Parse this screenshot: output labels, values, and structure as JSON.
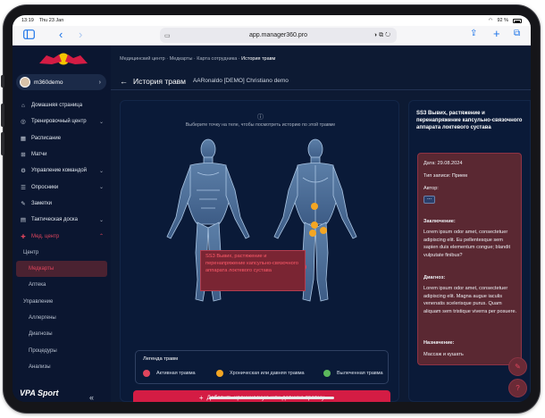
{
  "status_bar": {
    "time": "13:19",
    "date": "Thu 23 Jan",
    "battery": "92 %"
  },
  "browser": {
    "url": "app.manager360.pro"
  },
  "sidebar": {
    "user": "m360demo",
    "items": [
      {
        "label": "Домашняя страница",
        "icon": "home-icon"
      },
      {
        "label": "Тренировочный центр",
        "icon": "training-icon",
        "expand": true
      },
      {
        "label": "Расписание",
        "icon": "calendar-icon"
      },
      {
        "label": "Матчи",
        "icon": "match-icon"
      },
      {
        "label": "Управление командой",
        "icon": "team-icon",
        "expand": true
      },
      {
        "label": "Опросники",
        "icon": "survey-icon",
        "expand": true
      },
      {
        "label": "Заметки",
        "icon": "notes-icon"
      },
      {
        "label": "Тактическая доска",
        "icon": "tactics-icon",
        "expand": true
      },
      {
        "label": "Мед. центр",
        "icon": "medical-icon",
        "expand": true
      }
    ],
    "med_center": "Центр",
    "med_active": "Медкарты",
    "pharmacy": "Аптека",
    "management": "Управление",
    "sub_items": [
      "Аллергены",
      "Диагнозы",
      "Процедуры",
      "Анализы"
    ],
    "footer_logo": "VPA Sport"
  },
  "breadcrumb": {
    "items": [
      "Медицинский центр",
      "Медкарты",
      "Карта сотрудника"
    ],
    "current": "История травм"
  },
  "header": {
    "title": "История травм",
    "subtitle": "AARonaldo [DEMO] Christiano demo"
  },
  "body_map": {
    "hint": "Выберите точку на теле, чтобы посмотреть историю по этой травме",
    "tooltip": "SS3 Вывих, растяжение и перенапряжение капсульно-связочного аппарата локтевого сустава"
  },
  "legend": {
    "title": "Легенда травм",
    "items": [
      {
        "label": "Активная травма",
        "color": "#e0455d"
      },
      {
        "label": "Хроническая или давняя травма",
        "color": "#f4a623"
      },
      {
        "label": "Вылеченная травма",
        "color": "#5cb85c"
      }
    ]
  },
  "add_button": "Добавить хроническую или давнюю травму",
  "detail": {
    "title": "SS3 Вывих, растяжение и перенапряжение капсульно-связочного аппарата локтевого сустава",
    "date": "Дата: 29.08.2024",
    "type": "Тип записи: Прием",
    "author_label": "Автор:",
    "author_btn": "...",
    "conclusion_label": "Заключение:",
    "conclusion": "Lorem ipsum odor amet, consectetuer adipiscing elit. Eu pellentesque sem sapien duis elementum congue; blandit vulputate finibus?",
    "diagnosis_label": "Диагноз:",
    "diagnosis": "Lorem ipsum odor amet, consectetuer adipiscing elit. Magna augue iaculis venenatis scelerisque purus. Quam aliquam sem tristique viverra per posuere.",
    "prescription_label": "Назначение:",
    "prescription": "Массаж и кушать"
  }
}
